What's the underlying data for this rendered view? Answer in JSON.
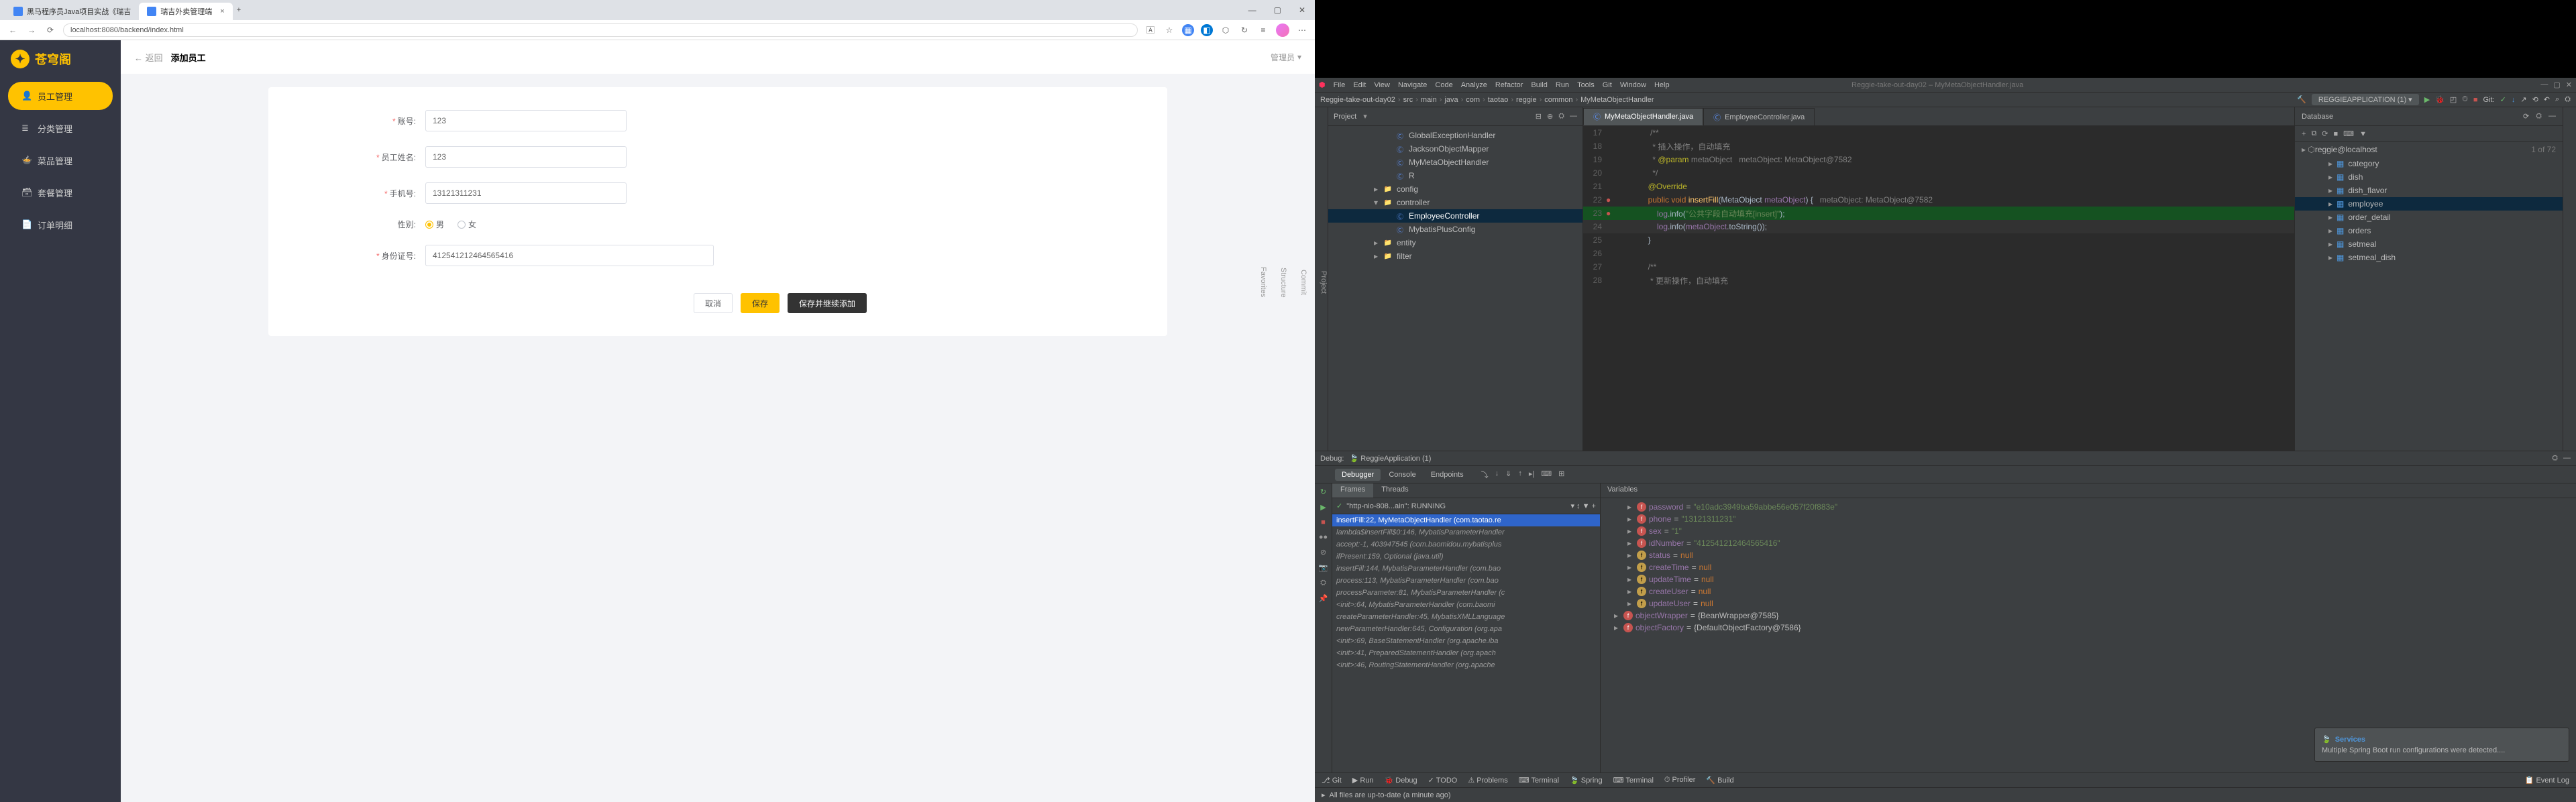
{
  "browser": {
    "tabs": [
      {
        "title": "黑马程序员Java项目实战《瑞吉"
      },
      {
        "title": "瑞吉外卖管理端"
      }
    ],
    "url": "localhost:8080/backend/index.html",
    "page_role": "管理员"
  },
  "sidebar": {
    "brand": "苍穹阁",
    "items": [
      {
        "label": "员工管理"
      },
      {
        "label": "分类管理"
      },
      {
        "label": "菜品管理"
      },
      {
        "label": "套餐管理"
      },
      {
        "label": "订单明细"
      }
    ]
  },
  "page": {
    "back": "返回",
    "title": "添加员工",
    "form": {
      "account_label": "账号:",
      "account_value": "123",
      "name_label": "员工姓名:",
      "name_value": "123",
      "phone_label": "手机号:",
      "phone_value": "13121311231",
      "sex_label": "性别:",
      "sex_male": "男",
      "sex_female": "女",
      "id_label": "身份证号:",
      "id_value": "412541212464565416",
      "btn_cancel": "取消",
      "btn_save": "保存",
      "btn_save_continue": "保存并继续添加"
    }
  },
  "ide": {
    "menu": [
      "File",
      "Edit",
      "View",
      "Navigate",
      "Code",
      "Analyze",
      "Refactor",
      "Build",
      "Run",
      "Tools",
      "Git",
      "Window",
      "Help"
    ],
    "context_title": "Reggie-take-out-day02 – MyMetaObjectHandler.java",
    "run_config": "REGGIEAPPLICATION (1)",
    "breadcrumb": [
      "Reggie-take-out-day02",
      "src",
      "main",
      "java",
      "com",
      "taotao",
      "reggie",
      "common",
      "MyMetaObjectHandler"
    ],
    "project_label": "Project",
    "tree_nodes": [
      {
        "depth": 3,
        "type": "class",
        "label": "GlobalExceptionHandler"
      },
      {
        "depth": 3,
        "type": "class",
        "label": "JacksonObjectMapper"
      },
      {
        "depth": 3,
        "type": "class",
        "label": "MyMetaObjectHandler"
      },
      {
        "depth": 3,
        "type": "class",
        "label": "R"
      },
      {
        "depth": 2,
        "type": "folder",
        "label": "config",
        "arrow": "▸"
      },
      {
        "depth": 2,
        "type": "folder",
        "label": "controller",
        "arrow": "▾",
        "open": true
      },
      {
        "depth": 3,
        "type": "class",
        "label": "EmployeeController",
        "selected": true
      },
      {
        "depth": 3,
        "type": "class",
        "label": "MybatisPlusConfig"
      },
      {
        "depth": 2,
        "type": "folder",
        "label": "entity",
        "arrow": "▸"
      },
      {
        "depth": 2,
        "type": "folder",
        "label": "filter",
        "arrow": "▸"
      }
    ],
    "editor_tabs": [
      {
        "label": "MyMetaObjectHandler.java",
        "active": true
      },
      {
        "label": "EmployeeController.java"
      }
    ],
    "code_lines": [
      {
        "n": 17,
        "html": "         <span class='cm'>/**</span>"
      },
      {
        "n": 18,
        "html": "         <span class='cm'> * 插入操作，自动填充</span>"
      },
      {
        "n": 19,
        "html": "         <span class='cm'> * <span class='ann'>@param</span> metaObject   metaObject: MetaObject@7582</span>"
      },
      {
        "n": 20,
        "html": "         <span class='cm'> */</span>"
      },
      {
        "n": 21,
        "html": "        <span class='ann'>@Override</span>"
      },
      {
        "n": 22,
        "html": "        <span class='kw'>public void</span> <span class='fn'>insertFill</span>(MetaObject <span class='prm'>metaObject</span>) {   <span class='cm'>metaObject: MetaObject@7582</span>",
        "gutter": "●"
      },
      {
        "n": 23,
        "html": "            <span class='prm'>log</span>.info(<span class='str'>\"公共字段自动填充[insert]\"</span>);",
        "hl": true,
        "gutter": "●"
      },
      {
        "n": 24,
        "html": "            <span class='prm'>log</span>.info(<span class='prm'>metaObject</span>.toString());",
        "cur": true
      },
      {
        "n": 25,
        "html": "        }"
      },
      {
        "n": 26,
        "html": ""
      },
      {
        "n": 27,
        "html": "        <span class='cm'>/**</span>"
      },
      {
        "n": 28,
        "html": "        <span class='cm'> * 更新操作，自动填充</span>"
      }
    ],
    "database_label": "Database",
    "db_host": "reggie@localhost",
    "db_total": "1 of 72",
    "db_tables": [
      {
        "label": "category"
      },
      {
        "label": "dish"
      },
      {
        "label": "dish_flavor"
      },
      {
        "label": "employee",
        "selected": true
      },
      {
        "label": "order_detail"
      },
      {
        "label": "orders"
      },
      {
        "label": "setmeal"
      },
      {
        "label": "setmeal_dish"
      }
    ],
    "debug_label": "Debug:",
    "debug_app": "ReggieApplication (1)",
    "debug_tabs": [
      {
        "label": "Debugger",
        "active": true
      },
      {
        "label": "Console"
      },
      {
        "label": "Endpoints"
      }
    ],
    "frames_tab": "Frames",
    "threads_tab": "Threads",
    "variables_tab": "Variables",
    "thread_name": "\"http-nio-808...ain\": RUNNING",
    "frames": [
      {
        "label": "insertFill:22, MyMetaObjectHandler (com.taotao.re",
        "selected": true
      },
      {
        "label": "lambda$insertFill$0:146, MybatisParameterHandler"
      },
      {
        "label": "accept:-1, 403947545 (com.baomidou.mybatisplus"
      },
      {
        "label": "ifPresent:159, Optional (java.util)"
      },
      {
        "label": "insertFill:144, MybatisParameterHandler (com.bao"
      },
      {
        "label": "process:113, MybatisParameterHandler (com.bao"
      },
      {
        "label": "processParameter:81, MybatisParameterHandler (c"
      },
      {
        "label": "<init>:64, MybatisParameterHandler (com.baomi"
      },
      {
        "label": "createParameterHandler:45, MybatisXMLLanguage"
      },
      {
        "label": "newParameterHandler:645, Configuration (org.apa"
      },
      {
        "label": "<init>:69, BaseStatementHandler (org.apache.iba"
      },
      {
        "label": "<init>:41, PreparedStatementHandler (org.apach"
      },
      {
        "label": "<init>:46, RoutingStatementHandler (org.apache"
      }
    ],
    "variables": [
      {
        "name": "password",
        "value": "\"e10adc3949ba59abbe56e057f20f883e\"",
        "type": "obj"
      },
      {
        "name": "phone",
        "value": "\"13121311231\"",
        "type": "obj"
      },
      {
        "name": "sex",
        "value": "\"1\"",
        "type": "obj"
      },
      {
        "name": "idNumber",
        "value": "\"412541212464565416\"",
        "type": "obj"
      },
      {
        "name": "status",
        "value": "null",
        "type": "null"
      },
      {
        "name": "createTime",
        "value": "null",
        "type": "null"
      },
      {
        "name": "updateTime",
        "value": "null",
        "type": "null"
      },
      {
        "name": "createUser",
        "value": "null",
        "type": "null"
      },
      {
        "name": "updateUser",
        "value": "null",
        "type": "null"
      },
      {
        "name": "objectWrapper",
        "value": "{BeanWrapper@7585}",
        "type": "obj",
        "sub": true
      },
      {
        "name": "objectFactory",
        "value": "{DefaultObjectFactory@7586}",
        "type": "obj",
        "sub": true
      }
    ],
    "status_items": [
      "Git",
      "Run",
      "Debug",
      "TODO",
      "Problems",
      "Terminal",
      "Spring",
      "Terminal",
      "Profiler",
      "Build"
    ],
    "event_log": "Event Log",
    "bottom_status": "All files are up-to-date (a minute ago)",
    "notification_title": "Services",
    "notification_body": "Multiple Spring Boot run configurations were detected...."
  }
}
